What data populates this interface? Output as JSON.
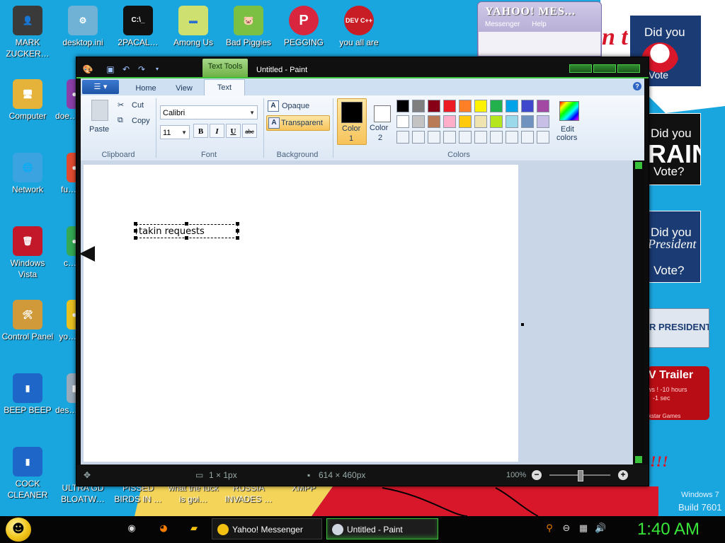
{
  "desktop": {
    "icons": [
      {
        "label": "MARK ZUCKER…",
        "glyph": "👤",
        "color": "#3a3a3a"
      },
      {
        "label": "desktop.ini",
        "glyph": "⚙",
        "color": "#6fb2d6"
      },
      {
        "label": "2PACAL…",
        "glyph": "C:\\_",
        "color": "#111111"
      },
      {
        "label": "Among Us",
        "glyph": "▬",
        "color": "#cde070"
      },
      {
        "label": "Bad Piggies",
        "glyph": "🐷",
        "color": "#7bc043"
      },
      {
        "label": "PEGGING",
        "glyph": "P",
        "color": "#d7263d"
      },
      {
        "label": "you all are",
        "glyph": "DEV C++",
        "color": "#c81d25"
      },
      {
        "label": "Computer",
        "glyph": "🖥",
        "color": "#e6b33a"
      },
      {
        "label": "doe…",
        "glyph": "●",
        "color": "#8a3ea8"
      },
      {
        "label": "Network",
        "glyph": "🌐",
        "color": "#3aa3e0"
      },
      {
        "label": "fu…",
        "glyph": "●",
        "color": "#e04a2f"
      },
      {
        "label": "Windows Vista",
        "glyph": "🗑",
        "color": "#c3182a"
      },
      {
        "label": "c…",
        "glyph": "●",
        "color": "#34a853"
      },
      {
        "label": "Control Panel",
        "glyph": "🛠",
        "color": "#d09a3a"
      },
      {
        "label": "yo…",
        "glyph": "●",
        "color": "#e8c020"
      },
      {
        "label": "BEEP BEEP",
        "glyph": "▮",
        "color": "#1e66c8"
      },
      {
        "label": "des…",
        "glyph": "▮",
        "color": "#9ab"
      },
      {
        "label": "COCK CLEANER",
        "glyph": "▮",
        "color": "#1e66c8"
      },
      {
        "label": "ULTRA GD BLOATW…",
        "glyph": "",
        "color": "#ffffff"
      },
      {
        "label": "PISSED BIRDS IN …",
        "glyph": "",
        "color": "#ffffff"
      },
      {
        "label": "what the fuck is goi…",
        "glyph": "",
        "color": "#ffffff"
      },
      {
        "label": "RUSSIA INVADES …",
        "glyph": "",
        "color": "#ffffff"
      },
      {
        "label": "XMPP",
        "glyph": "",
        "color": "#ffffff"
      }
    ],
    "watermark_line1": "Windows 7",
    "watermark_line2": "Build 7601",
    "right_posters": {
      "poster1_text": "Did you",
      "poster1_sub": "Vote",
      "poster2_text": "Did you",
      "poster2_big": "RAIN",
      "poster2_sub": "Vote?",
      "poster3_text": "Did you",
      "poster3_italic": "President",
      "poster3_sub": "Vote?",
      "poster4_text": "R PRESIDENT",
      "poster5_title": "V Trailer",
      "poster5_line1": "ws ! -10 hours",
      "poster5_line2": "-1 sec",
      "poster5_line3": "kstar Games",
      "red_text": "n t",
      "exclaim": "!!!"
    }
  },
  "yahoo_window": {
    "title": "YAHOO! MES...",
    "menu_messenger": "Messenger",
    "menu_help": "Help"
  },
  "paint": {
    "title": "Untitled - Paint",
    "context_tab": "Text Tools",
    "tabs": [
      {
        "label": "Home"
      },
      {
        "label": "View"
      },
      {
        "label": "Text"
      }
    ],
    "help": "?",
    "clipboard": {
      "paste": "Paste",
      "cut": "Cut",
      "copy": "Copy",
      "label": "Clipboard"
    },
    "font": {
      "family": "Calibri",
      "size": "11",
      "bold": "B",
      "italic": "I",
      "underline": "U",
      "strike": "abc",
      "label": "Font"
    },
    "background": {
      "opaque": "Opaque",
      "transparent": "Transparent",
      "label": "Background"
    },
    "colors": {
      "color1_label_a": "Color",
      "color1_label_b": "1",
      "color2_label_a": "Color",
      "color2_label_b": "2",
      "edit_a": "Edit",
      "edit_b": "colors",
      "label": "Colors",
      "color1": "#000000",
      "color2": "#ffffff",
      "row1": [
        "#000000",
        "#7f7f7f",
        "#880015",
        "#ed1c24",
        "#ff7f27",
        "#fff200",
        "#22b14c",
        "#00a2e8",
        "#3f48cc",
        "#a349a4"
      ],
      "row2": [
        "#ffffff",
        "#c3c3c3",
        "#b97a57",
        "#ffaec9",
        "#ffc90e",
        "#efe4b0",
        "#b5e61d",
        "#99d9ea",
        "#7092be",
        "#c8bfe7"
      ],
      "row3": [
        "#eef3fa",
        "#eef3fa",
        "#eef3fa",
        "#eef3fa",
        "#eef3fa",
        "#eef3fa",
        "#eef3fa",
        "#eef3fa",
        "#eef3fa",
        "#eef3fa"
      ]
    },
    "canvas_text": "takin requests",
    "status": {
      "selection": "1 × 1px",
      "image_size": "614 × 460px",
      "zoom": "100%",
      "zoom_level": 0.5
    }
  },
  "taskbar": {
    "yahoo_button": "Yahoo! Messenger",
    "paint_button": "Untitled - Paint",
    "clock": "1:40 AM"
  }
}
